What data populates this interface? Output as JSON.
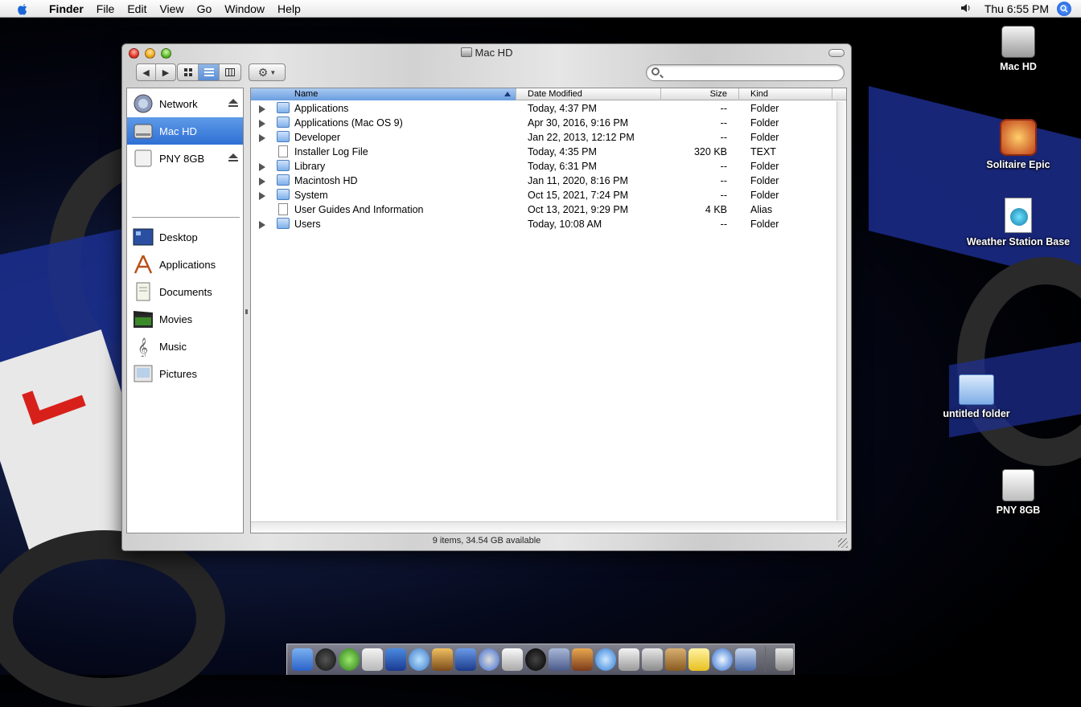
{
  "menubar": {
    "app": "Finder",
    "items": [
      "File",
      "Edit",
      "View",
      "Go",
      "Window",
      "Help"
    ],
    "clock": "Thu 6:55 PM"
  },
  "window": {
    "title": "Mac HD",
    "search": {
      "placeholder": "",
      "value": ""
    },
    "status": "9 items, 34.54 GB available",
    "view_mode": "list"
  },
  "sidebar": {
    "items": [
      {
        "label": "Network",
        "icon": "network-icon",
        "eject": true
      },
      {
        "label": "Mac HD",
        "icon": "hard-drive-icon",
        "selected": true
      },
      {
        "label": "PNY 8GB",
        "icon": "usb-drive-icon",
        "eject": true
      },
      {
        "label": "Desktop",
        "icon": "desktop-icon"
      },
      {
        "label": "Applications",
        "icon": "applications-icon"
      },
      {
        "label": "Documents",
        "icon": "documents-icon"
      },
      {
        "label": "Movies",
        "icon": "movies-icon"
      },
      {
        "label": "Music",
        "icon": "music-icon"
      },
      {
        "label": "Pictures",
        "icon": "pictures-icon"
      }
    ]
  },
  "list": {
    "columns": [
      "Name",
      "Date Modified",
      "Size",
      "Kind"
    ],
    "rows": [
      {
        "name": "Applications",
        "date": "Today, 4:37 PM",
        "size": "--",
        "kind": "Folder"
      },
      {
        "name": "Applications (Mac OS 9)",
        "date": "Apr 30, 2016, 9:16 PM",
        "size": "--",
        "kind": "Folder"
      },
      {
        "name": "Developer",
        "date": "Jan 22, 2013, 12:12 PM",
        "size": "--",
        "kind": "Folder"
      },
      {
        "name": "Installer Log File",
        "date": "Today, 4:35 PM",
        "size": "320 KB",
        "kind": "TEXT"
      },
      {
        "name": "Library",
        "date": "Today, 6:31 PM",
        "size": "--",
        "kind": "Folder"
      },
      {
        "name": "Macintosh HD",
        "date": "Jan 11, 2020, 8:16 PM",
        "size": "--",
        "kind": "Folder"
      },
      {
        "name": "System",
        "date": "Oct 15, 2021, 7:24 PM",
        "size": "--",
        "kind": "Folder"
      },
      {
        "name": "User Guides And Information",
        "date": "Oct 13, 2021, 9:29 PM",
        "size": "4 KB",
        "kind": "Alias"
      },
      {
        "name": "Users",
        "date": "Today, 10:08 AM",
        "size": "--",
        "kind": "Folder"
      }
    ]
  },
  "desktop_icons": [
    {
      "label": "Mac HD",
      "icon": "hard-drive-icon"
    },
    {
      "label": "Solitaire Epic",
      "icon": "solitaire-icon"
    },
    {
      "label": "Weather Station Base",
      "icon": "document-icon"
    },
    {
      "label": "untitled folder",
      "icon": "folder-icon"
    },
    {
      "label": "PNY 8GB",
      "icon": "usb-drive-icon"
    }
  ],
  "dock": {
    "apps": [
      "finder-icon",
      "dashboard-icon",
      "network-diag-icon",
      "mail-icon",
      "image-capture-icon",
      "itunes-icon",
      "iphoto-icon",
      "imovie-icon",
      "dvd-player-icon",
      "printer-icon",
      "music-player-icon",
      "mail-app-icon",
      "garageband-icon",
      "quicktime-icon",
      "preview-icon",
      "photos-icon",
      "address-book-icon",
      "stickies-icon",
      "safari-icon",
      "xcode-icon",
      "trash-icon"
    ]
  },
  "colors": {
    "selection": "#2f6fd4",
    "header_sorted": "#6a9ee0"
  }
}
